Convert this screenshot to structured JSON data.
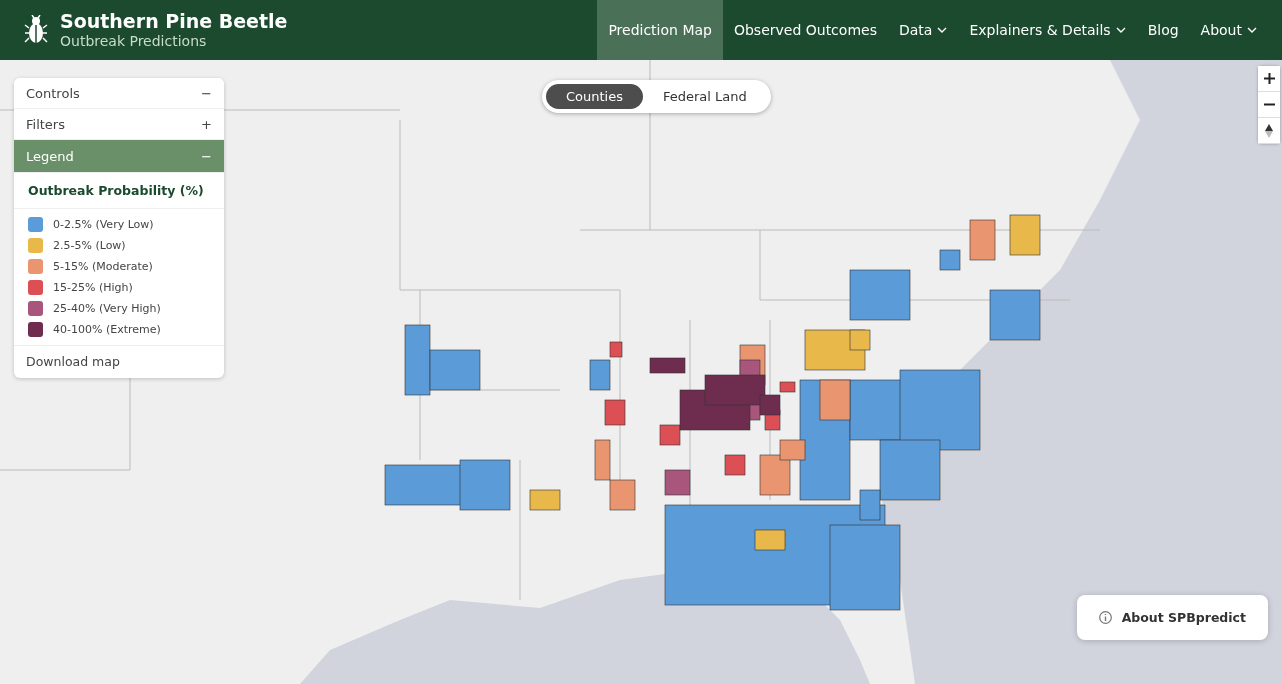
{
  "header": {
    "title": "Southern Pine Beetle",
    "subtitle": "Outbreak Predictions"
  },
  "nav": [
    {
      "label": "Prediction Map",
      "selected": true,
      "dropdown": false
    },
    {
      "label": "Observed Outcomes",
      "selected": false,
      "dropdown": false
    },
    {
      "label": "Data",
      "selected": false,
      "dropdown": true
    },
    {
      "label": "Explainers & Details",
      "selected": false,
      "dropdown": true
    },
    {
      "label": "Blog",
      "selected": false,
      "dropdown": false
    },
    {
      "label": "About",
      "selected": false,
      "dropdown": true
    }
  ],
  "layer_toggle": [
    {
      "label": "Counties",
      "selected": true
    },
    {
      "label": "Federal Land",
      "selected": false
    }
  ],
  "panel": {
    "sections": [
      {
        "label": "Controls",
        "toggle": "−",
        "active": false
      },
      {
        "label": "Filters",
        "toggle": "+",
        "active": false
      },
      {
        "label": "Legend",
        "toggle": "−",
        "active": true
      }
    ],
    "legend": {
      "title": "Outbreak Probability (%)",
      "items": [
        {
          "label": "0-2.5% (Very Low)",
          "color": "#5b9bd8"
        },
        {
          "label": "2.5-5% (Low)",
          "color": "#e8b84a"
        },
        {
          "label": "5-15% (Moderate)",
          "color": "#e9956f"
        },
        {
          "label": "15-25% (High)",
          "color": "#dc4f54"
        },
        {
          "label": "25-40% (Very High)",
          "color": "#a8567c"
        },
        {
          "label": "40-100% (Extreme)",
          "color": "#6e2d4f"
        }
      ]
    },
    "download": "Download map"
  },
  "about_button": "About SPBpredict"
}
